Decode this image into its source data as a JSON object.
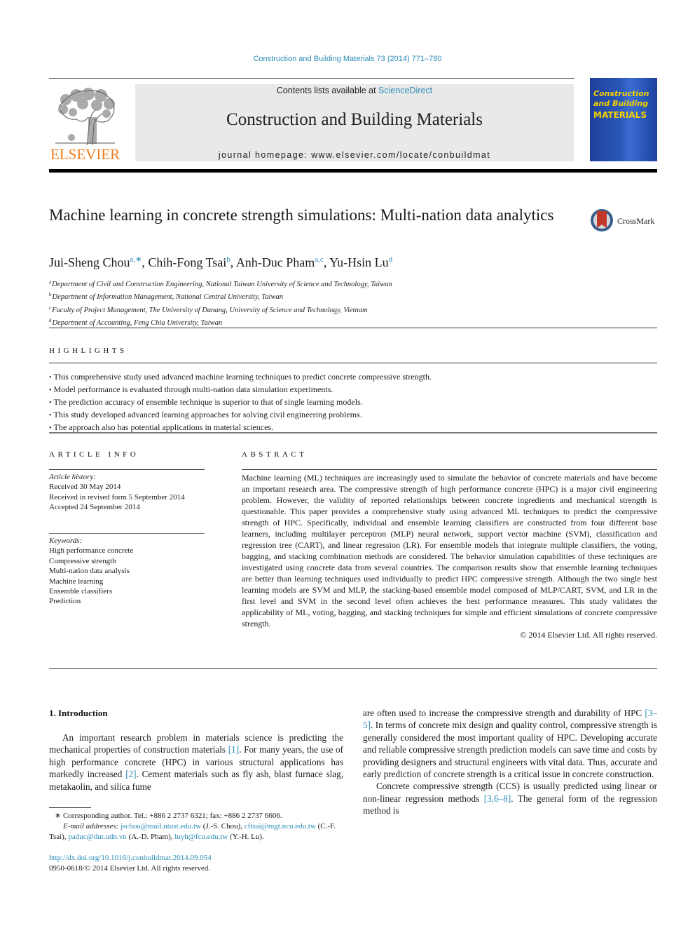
{
  "header": {
    "citation": "Construction and Building Materials 73 (2014) 771–780",
    "contents_prefix": "Contents lists available at ",
    "contents_link": "ScienceDirect",
    "journal_name": "Construction and Building Materials",
    "homepage_label": "journal homepage: ",
    "homepage_url": "www.elsevier.com/locate/conbuildmat",
    "publisher_logo": "ELSEVIER",
    "cover": {
      "line1": "Construction",
      "line2": "and Building",
      "line3": "MATERIALS"
    }
  },
  "article": {
    "title": "Machine learning in concrete strength simulations: Multi-nation data analytics",
    "crossmark_label": "CrossMark",
    "authors": [
      {
        "name": "Jui-Sheng Chou",
        "sup": "a,∗",
        "sep": ", "
      },
      {
        "name": "Chih-Fong Tsai",
        "sup": "b",
        "sep": ", "
      },
      {
        "name": "Anh-Duc Pham",
        "sup": "a,c",
        "sep": ", "
      },
      {
        "name": "Yu-Hsin Lu",
        "sup": "d",
        "sep": ""
      }
    ],
    "affiliations": [
      {
        "key": "a",
        "text": "Department of Civil and Construction Engineering, National Taiwan University of Science and Technology, Taiwan"
      },
      {
        "key": "b",
        "text": "Department of Information Management, National Central University, Taiwan"
      },
      {
        "key": "c",
        "text": "Faculty of Project Management, The University of Danang, University of Science and Technology, Vietnam"
      },
      {
        "key": "d",
        "text": "Department of Accounting, Feng Chia University, Taiwan"
      }
    ]
  },
  "highlights": {
    "heading": "HIGHLIGHTS",
    "items": [
      "This comprehensive study used advanced machine learning techniques to predict concrete compressive strength.",
      "Model performance is evaluated through multi-nation data simulation experiments.",
      "The prediction accuracy of ensemble technique is superior to that of single learning models.",
      "This study developed advanced learning approaches for solving civil engineering problems.",
      "The approach also has potential applications in material sciences."
    ]
  },
  "article_info": {
    "heading": "ARTICLE INFO",
    "history_label": "Article history:",
    "history": [
      "Received 30 May 2014",
      "Received in revised form 5 September 2014",
      "Accepted 24 September 2014"
    ],
    "keywords_label": "Keywords:",
    "keywords": [
      "High performance concrete",
      "Compressive strength",
      "Multi-nation data analysis",
      "Machine learning",
      "Ensemble classifiers",
      "Prediction"
    ]
  },
  "abstract": {
    "heading": "ABSTRACT",
    "text": "Machine learning (ML) techniques are increasingly used to simulate the behavior of concrete materials and have become an important research area. The compressive strength of high performance concrete (HPC) is a major civil engineering problem. However, the validity of reported relationships between concrete ingredients and mechanical strength is questionable. This paper provides a comprehensive study using advanced ML techniques to predict the compressive strength of HPC. Specifically, individual and ensemble learning classifiers are constructed from four different base learners, including multilayer perceptron (MLP) neural network, support vector machine (SVM), classification and regression tree (CART), and linear regression (LR). For ensemble models that integrate multiple classifiers, the voting, bagging, and stacking combination methods are considered. The behavior simulation capabilities of these techniques are investigated using concrete data from several countries. The comparison results show that ensemble learning techniques are better than learning techniques used individually to predict HPC compressive strength. Although the two single best learning models are SVM and MLP, the stacking-based ensemble model composed of MLP/CART, SVM, and LR in the first level and SVM in the second level often achieves the best performance measures. This study validates the applicability of ML, voting, bagging, and stacking techniques for simple and efficient simulations of concrete compressive strength.",
    "copyright": "© 2014 Elsevier Ltd. All rights reserved."
  },
  "introduction": {
    "heading": "1. Introduction",
    "left_para": {
      "t1": "An important research problem in materials science is predicting the mechanical properties of construction materials ",
      "r1": "[1]",
      "t2": ". For many years, the use of high performance concrete (HPC) in various structural applications has markedly increased ",
      "r2": "[2]",
      "t3": ". Cement materials such as fly ash, blast furnace slag, metakaolin, and silica fume"
    },
    "right_para1": {
      "t1": "are often used to increase the compressive strength and durability of HPC ",
      "r1": "[3–5]",
      "t2": ". In terms of concrete mix design and quality control, compressive strength is generally considered the most important quality of HPC. Developing accurate and reliable compressive strength prediction models can save time and costs by providing designers and structural engineers with vital data. Thus, accurate and early prediction of concrete strength is a critical issue in concrete construction."
    },
    "right_para2": {
      "t1": "Concrete compressive strength (CCS) is usually predicted using linear or non-linear regression methods ",
      "r1": "[3,6–8]",
      "t2": ". The general form of the regression method is"
    }
  },
  "footnote": {
    "corresponding": "∗ Corresponding author. Tel.: +886 2 2737 6321; fax: +886 2 2737 6606.",
    "email_label": "E-mail addresses: ",
    "emails": [
      {
        "addr": "jschou@mail.ntust.edu.tw",
        "who": " (J.-S. Chou), "
      },
      {
        "addr": "cftsai@mgt.ncu.edu.tw",
        "who": " (C.-F. Tsai), "
      },
      {
        "addr": "paduc@dut.udn.vn",
        "who": " (A.-D. Pham), "
      },
      {
        "addr": "luyh@fcu.edu.tw",
        "who": " (Y.-H. Lu)."
      }
    ],
    "doi": "http://dx.doi.org/10.1016/j.conbuildmat.2014.09.054",
    "issn": "0950-0618/© 2014 Elsevier Ltd. All rights reserved."
  },
  "colors": {
    "link": "#2a8cb8",
    "elsevier_orange": "#f07a1a",
    "header_gray": "#e9e9e9",
    "cover_blue": "#2a58b8",
    "cover_yellow": "#f4d000"
  }
}
